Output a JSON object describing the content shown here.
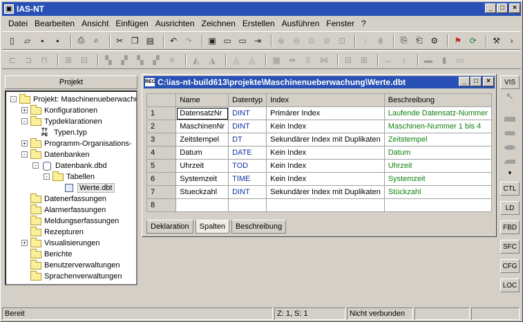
{
  "app": {
    "title": "IAS-NT"
  },
  "menu": [
    "Datei",
    "Bearbeiten",
    "Ansicht",
    "Einfügen",
    "Ausrichten",
    "Zeichnen",
    "Erstellen",
    "Ausführen",
    "Fenster",
    "?"
  ],
  "project": {
    "header": "Projekt",
    "tree": [
      {
        "label": "Projekt: Maschinenueberwachung",
        "level": 0,
        "icon": "folder",
        "exp": "-"
      },
      {
        "label": "Konfigurationen",
        "level": 1,
        "icon": "folder",
        "exp": "+"
      },
      {
        "label": "Typdeklarationen",
        "level": 1,
        "icon": "folder",
        "exp": "-"
      },
      {
        "label": "Typen.typ",
        "level": 2,
        "icon": "typ",
        "exp": ""
      },
      {
        "label": "Programm-Organisations-",
        "level": 1,
        "icon": "folder",
        "exp": "+"
      },
      {
        "label": "Datenbanken",
        "level": 1,
        "icon": "folder",
        "exp": "-"
      },
      {
        "label": "Datenbank.dbd",
        "level": 2,
        "icon": "db",
        "exp": "-"
      },
      {
        "label": "Tabellen",
        "level": 3,
        "icon": "folder",
        "exp": "-"
      },
      {
        "label": "Werte.dbt",
        "level": 4,
        "icon": "table",
        "exp": ""
      },
      {
        "label": "Datenerfassungen",
        "level": 1,
        "icon": "folder",
        "exp": ""
      },
      {
        "label": "Alarmerfassungen",
        "level": 1,
        "icon": "folder",
        "exp": ""
      },
      {
        "label": "Meldungserfassungen",
        "level": 1,
        "icon": "folder",
        "exp": ""
      },
      {
        "label": "Rezepturen",
        "level": 1,
        "icon": "folder",
        "exp": ""
      },
      {
        "label": "Visualisierungen",
        "level": 1,
        "icon": "folder",
        "exp": "+"
      },
      {
        "label": "Berichte",
        "level": 1,
        "icon": "folder",
        "exp": ""
      },
      {
        "label": "Benutzerverwaltungen",
        "level": 1,
        "icon": "folder",
        "exp": ""
      },
      {
        "label": "Sprachenverwaltungen",
        "level": 1,
        "icon": "folder",
        "exp": ""
      }
    ]
  },
  "doc": {
    "title": "C:\\ias-nt-build613\\projekte\\Maschinenueberwachung\\Werte.dbt",
    "icon_text": "REC",
    "columns": [
      "Name",
      "Datentyp",
      "Index",
      "Beschreibung"
    ],
    "rows": [
      [
        "1",
        "DatensatzNr",
        "DINT",
        "Primärer Index",
        "Laufende Datensatz-Nummer"
      ],
      [
        "2",
        "MaschinenNr",
        "DINT",
        "Kein Index",
        "Maschinen-Nummer 1 bis 4"
      ],
      [
        "3",
        "Zeitstempel",
        "DT",
        "Sekundärer Index mit Duplikaten",
        "Zeitstempel"
      ],
      [
        "4",
        "Datum",
        "DATE",
        "Kein Index",
        "Datum"
      ],
      [
        "5",
        "Uhrzeit",
        "TOD",
        "Kein Index",
        "Uhrzeit"
      ],
      [
        "6",
        "Systemzeit",
        "TIME",
        "Kein Index",
        "Systemzeit"
      ],
      [
        "7",
        "Stueckzahl",
        "DINT",
        "Sekundärer Index mit Duplikaten",
        "Stückzahl"
      ],
      [
        "8",
        "",
        "",
        "",
        ""
      ]
    ],
    "tabs": [
      "Deklaration",
      "Spalten",
      "Beschreibung"
    ],
    "active_tab": 1
  },
  "right_panel": [
    "VIS",
    "CTL",
    "LD",
    "FBD",
    "SFC",
    "CFG",
    "LOC"
  ],
  "status": {
    "ready": "Bereit",
    "pos": "Z: 1, S: 1",
    "conn": "Nicht verbunden"
  }
}
